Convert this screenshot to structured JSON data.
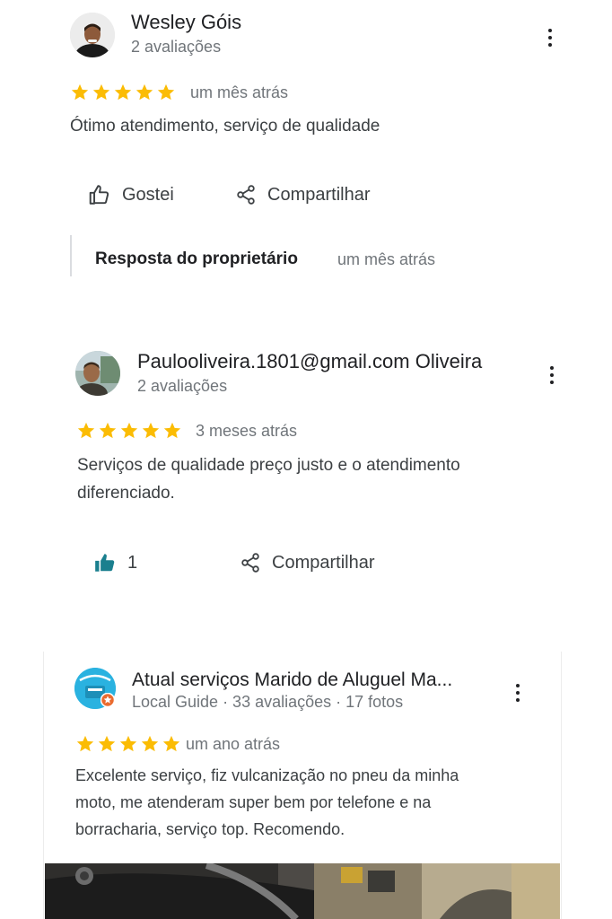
{
  "reviews": [
    {
      "name": "Wesley Góis",
      "meta": "2 avaliações",
      "rating": 5,
      "time": "um mês atrás",
      "text": "Ótimo atendimento, serviço de qualidade",
      "like_label": "Gostei",
      "share_label": "Compartilhar",
      "owner_response_label": "Resposta do proprietário",
      "owner_response_time": "um mês atrás"
    },
    {
      "name": "Paulooliveira.1801@gmail.com Oliveira",
      "meta": "2 avaliações",
      "rating": 5,
      "time": "3 meses atrás",
      "text_line1": "Serviços de qualidade preço justo e o atendimento",
      "text_line2": "diferenciado.",
      "like_count": "1",
      "share_label": "Compartilhar"
    },
    {
      "name": "Atual serviços Marido de Aluguel Ma...",
      "meta": "Local Guide · 33 avaliações · 17 fotos",
      "rating": 5,
      "time": "um ano atrás",
      "text_line1": "Excelente serviço, fiz vulcanização no pneu da minha",
      "text_line2": "moto, me atenderam super bem por telefone e na",
      "text_line3": "borracharia, serviço top. Recomendo."
    }
  ],
  "colors": {
    "star": "#fbbc04",
    "like_active": "#1a7f8e",
    "text": "#3c4043",
    "secondary": "#70757a"
  }
}
